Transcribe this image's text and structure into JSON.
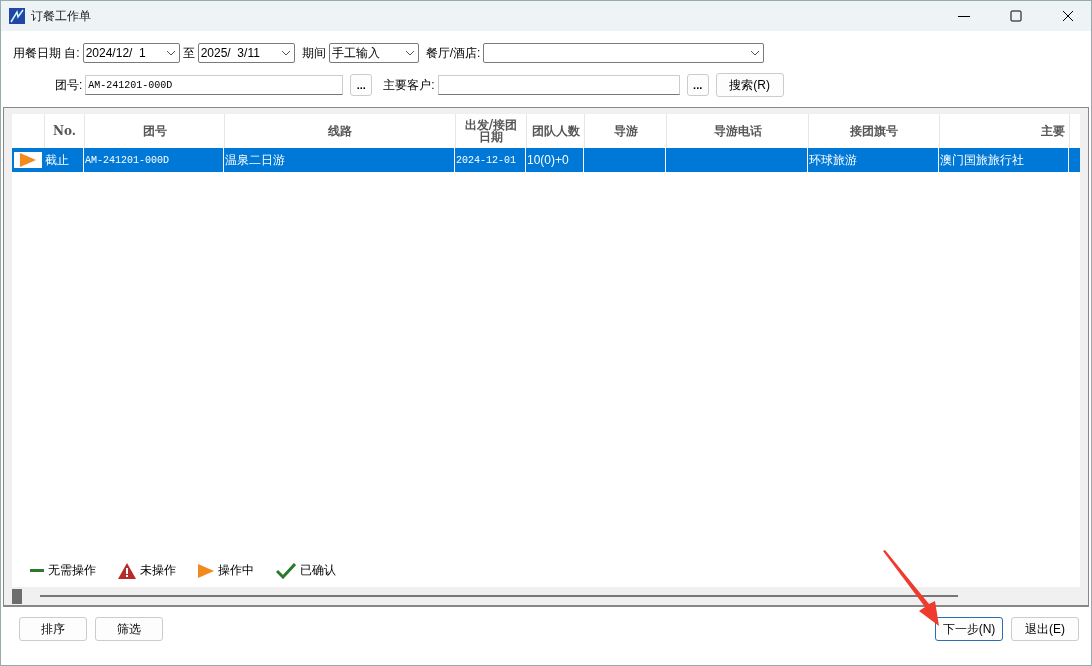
{
  "window": {
    "title": "订餐工作单"
  },
  "filters": {
    "date_label": "用餐日期 自:",
    "date_from": "2024/12/  1",
    "to_label": "至",
    "date_to": "2025/  3/11",
    "period_label": "期间",
    "period": "手工输入",
    "restaurant_label": "餐厅/酒店:",
    "group_label": "团号:",
    "group_no": "AM-241201-000D",
    "browse_button": "...",
    "customer_label": "主要客户:",
    "customer_browse_button": "...",
    "search_button": "搜索(R)"
  },
  "table": {
    "columns": [
      "No.",
      "团号",
      "线路",
      "出发/接团日期",
      "团队人数",
      "导游",
      "导游电话",
      "接团旗号",
      "主要"
    ],
    "rows": [
      {
        "kind": "in_progress",
        "selected": true,
        "cells": [
          "截止",
          "AM-241201-000D",
          "温泉二日游",
          "2024-12-01",
          "10(0)+0",
          "",
          "",
          "环球旅游",
          "澳门国旅旅行社"
        ]
      }
    ]
  },
  "legend": [
    {
      "kind": "none",
      "label": "无需操作"
    },
    {
      "kind": "not_started",
      "label": "未操作"
    },
    {
      "kind": "in_progress",
      "label": "操作中"
    },
    {
      "kind": "confirmed",
      "label": "已确认"
    }
  ],
  "footer": {
    "left_buttons": [
      {
        "label": "排序",
        "focused": false
      },
      {
        "label": "筛选",
        "focused": false
      }
    ],
    "right_buttons": [
      {
        "label": "下一步(N)",
        "focused": true
      },
      {
        "label": "退出(E)",
        "focused": false
      }
    ]
  }
}
